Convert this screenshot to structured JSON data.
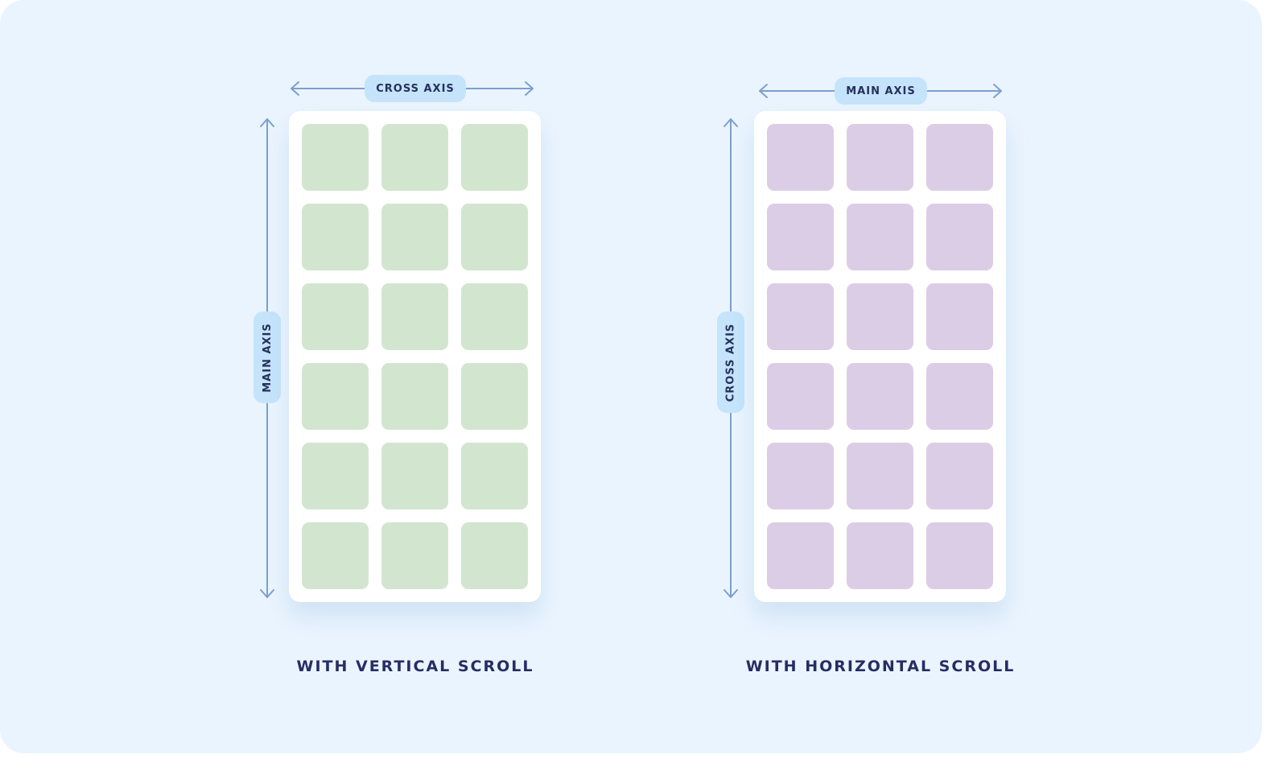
{
  "colors": {
    "background": "#eaf4fe",
    "card": "#ffffff",
    "tile_left": "#d2e6cf",
    "tile_right": "#dccde6",
    "axis_line": "#7c9fce",
    "pill": "#c5e4fb",
    "text": "#262d63"
  },
  "left": {
    "top_axis_label": "CROSS AXIS",
    "side_axis_label": "MAIN AXIS",
    "caption": "WITH VERTICAL SCROLL",
    "rows": 6,
    "columns": 3
  },
  "right": {
    "top_axis_label": "MAIN AXIS",
    "side_axis_label": "CROSS AXIS",
    "caption": "WITH HORIZONTAL SCROLL",
    "rows": 6,
    "columns": 3
  },
  "icons": [
    "double-arrow-horizontal-icon",
    "double-arrow-vertical-icon"
  ]
}
